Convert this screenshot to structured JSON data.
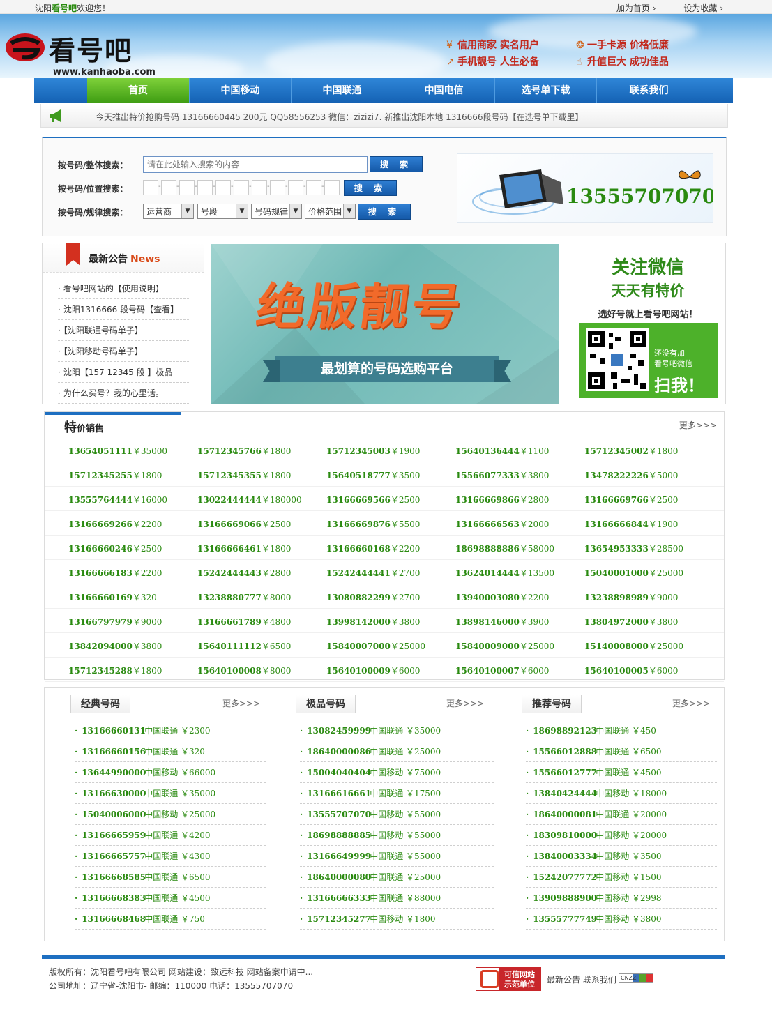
{
  "topbar": {
    "welcome_prefix": "沈阳",
    "welcome_brand": "看号吧",
    "welcome_suffix": "欢迎您！",
    "set_home": "加为首页",
    "bookmark": "设为收藏"
  },
  "header": {
    "logo_text": "看号吧",
    "logo_url": "www.kanhaoba.com",
    "slogans": [
      "信用商家 实名用户",
      "一手卡源 价格低廉",
      "手机靓号 人生必备",
      "升值巨大 成功佳品"
    ]
  },
  "nav": {
    "items": [
      "首页",
      "中国移动",
      "中国联通",
      "中国电信",
      "选号单下载",
      "联系我们"
    ]
  },
  "ticker": {
    "text": "今天推出特价抢购号码 13166660445 200元 QQ58556253   微信：zizizi7.      新推出沈阳本地   1316666段号码【在选号单下载里】"
  },
  "search": {
    "label_whole": "按号码/整体搜索：",
    "placeholder": "请在此处输入搜索的内容",
    "label_position": "按号码/位置搜索：",
    "label_rule": "按号码/规律搜索：",
    "button": "搜 索",
    "selects": [
      "运营商",
      "号段",
      "号码规律",
      "价格范围"
    ],
    "banner_number": "13555707070"
  },
  "news": {
    "title": "最新公告",
    "title_en": "News",
    "items": [
      "看号吧网站的【使用说明】",
      "沈阳1316666 段号码【查看】",
      "【沈阳联通号码单子】",
      "【沈阳移动号码单子】",
      "沈阳【157 12345 段 】极品",
      "为什么买号？我的心里话。"
    ]
  },
  "banner": {
    "headline": "绝版靓号",
    "tagline": "最划算的号码选购平台"
  },
  "wechat": {
    "line1": "关注微信",
    "line2": "天天有特价",
    "line3": "选好号就上看号吧网站！",
    "hint1": "还没有加",
    "hint2": "看号吧微信",
    "scan": "扫我！"
  },
  "special": {
    "title_big": "特",
    "title_small": "价销售",
    "more": "更多>>>",
    "rows": [
      [
        [
          "13654051111",
          "￥35000"
        ],
        [
          "15712345766",
          "￥1800"
        ],
        [
          "15712345003",
          "￥1900"
        ],
        [
          "15640136444",
          "￥1100"
        ],
        [
          "15712345002",
          "￥1800"
        ]
      ],
      [
        [
          "15712345255",
          "￥1800"
        ],
        [
          "15712345355",
          "￥1800"
        ],
        [
          "15640518777",
          "￥3500"
        ],
        [
          "15566077333",
          "￥3800"
        ],
        [
          "13478222226",
          "￥5000"
        ]
      ],
      [
        [
          "13555764444",
          "￥16000"
        ],
        [
          "13022444444",
          "￥180000"
        ],
        [
          "13166669566",
          "￥2500"
        ],
        [
          "13166669866",
          "￥2800"
        ],
        [
          "13166669766",
          "￥2500"
        ]
      ],
      [
        [
          "13166669266",
          "￥2200"
        ],
        [
          "13166669066",
          "￥2500"
        ],
        [
          "13166669876",
          "￥5500"
        ],
        [
          "13166666563",
          "￥2000"
        ],
        [
          "13166666844",
          "￥1900"
        ]
      ],
      [
        [
          "13166660246",
          "￥2500"
        ],
        [
          "13166666461",
          "￥1800"
        ],
        [
          "13166660168",
          "￥2200"
        ],
        [
          "18698888886",
          "￥58000"
        ],
        [
          "13654953333",
          "￥28500"
        ]
      ],
      [
        [
          "13166666183",
          "￥2200"
        ],
        [
          "15242444443",
          "￥2800"
        ],
        [
          "15242444441",
          "￥2700"
        ],
        [
          "13624014444",
          "￥13500"
        ],
        [
          "15040001000",
          "￥25000"
        ]
      ],
      [
        [
          "13166660169",
          "￥320"
        ],
        [
          "13238880777",
          "￥8000"
        ],
        [
          "13080882299",
          "￥2700"
        ],
        [
          "13940003080",
          "￥2200"
        ],
        [
          "13238898989",
          "￥9000"
        ]
      ],
      [
        [
          "13166797979",
          "￥9000"
        ],
        [
          "13166661789",
          "￥4800"
        ],
        [
          "13998142000",
          "￥3800"
        ],
        [
          "13898146000",
          "￥3900"
        ],
        [
          "13804972000",
          "￥3800"
        ]
      ],
      [
        [
          "13842094000",
          "￥3800"
        ],
        [
          "15640111112",
          "￥6500"
        ],
        [
          "15840007000",
          "￥25000"
        ],
        [
          "15840009000",
          "￥25000"
        ],
        [
          "15140008000",
          "￥25000"
        ]
      ],
      [
        [
          "15712345288",
          "￥1800"
        ],
        [
          "15640100008",
          "￥8000"
        ],
        [
          "15640100009",
          "￥6000"
        ],
        [
          "15640100007",
          "￥6000"
        ],
        [
          "15640100005",
          "￥6000"
        ]
      ]
    ]
  },
  "lists": [
    {
      "title": "经典号码",
      "more": "更多>>>",
      "rows": [
        [
          "13166660131",
          "中国联通 ￥2300"
        ],
        [
          "13166660156",
          "中国联通 ￥320"
        ],
        [
          "13644990000",
          "中国移动 ￥66000"
        ],
        [
          "13166630000",
          "中国联通 ￥35000"
        ],
        [
          "15040006000",
          "中国移动 ￥25000"
        ],
        [
          "13166665959",
          "中国联通 ￥4200"
        ],
        [
          "13166665757",
          "中国联通 ￥4300"
        ],
        [
          "13166668585",
          "中国联通 ￥6500"
        ],
        [
          "13166668383",
          "中国联通 ￥4500"
        ],
        [
          "13166668468",
          "中国联通 ￥750"
        ]
      ]
    },
    {
      "title": "极品号码",
      "more": "更多>>>",
      "rows": [
        [
          "13082459999",
          "中国联通 ￥35000"
        ],
        [
          "18640000086",
          "中国联通 ￥25000"
        ],
        [
          "15004040404",
          "中国移动 ￥75000"
        ],
        [
          "13166616661",
          "中国联通 ￥17500"
        ],
        [
          "13555707070",
          "中国移动 ￥55000"
        ],
        [
          "18698888885",
          "中国移动 ￥55000"
        ],
        [
          "13166649999",
          "中国联通 ￥55000"
        ],
        [
          "18640000080",
          "中国联通 ￥25000"
        ],
        [
          "13166666333",
          "中国联通 ￥88000"
        ],
        [
          "15712345277",
          "中国移动 ￥1800"
        ]
      ]
    },
    {
      "title": "推荐号码",
      "more": "更多>>>",
      "rows": [
        [
          "18698892123",
          "中国联通 ￥450"
        ],
        [
          "15566012888",
          "中国联通 ￥6500"
        ],
        [
          "15566012777",
          "中国联通 ￥4500"
        ],
        [
          "13840424444",
          "中国移动 ￥18000"
        ],
        [
          "18640000081",
          "中国联通 ￥20000"
        ],
        [
          "18309810000",
          "中国移动 ￥20000"
        ],
        [
          "13840003334",
          "中国移动 ￥3500"
        ],
        [
          "15242077772",
          "中国移动 ￥1500"
        ],
        [
          "13909888900",
          "中国移动 ￥2998"
        ],
        [
          "13555777749",
          "中国移动 ￥3800"
        ]
      ]
    }
  ],
  "footer": {
    "line1": "版权所有：沈阳看号吧有限公司 网站建设：致远科技 网站备案申请中...",
    "line2": "公司地址：辽宁省-沈阳市- 邮编：110000 电话：13555707070",
    "badge_line1": "可信网站",
    "badge_line2": "示范单位",
    "links": "最新公告 联系我们",
    "cnzz": "CNZZ"
  }
}
